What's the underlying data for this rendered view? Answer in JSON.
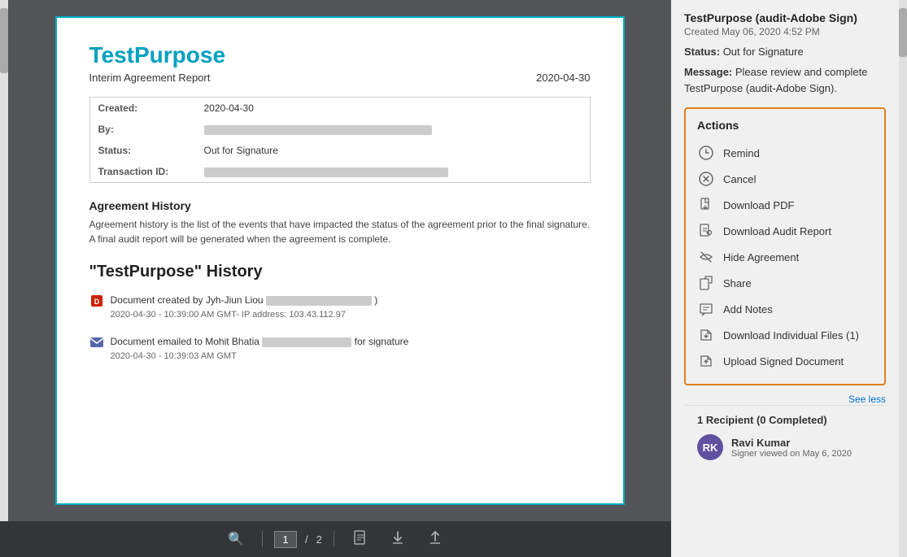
{
  "document": {
    "title": "TestPurpose",
    "subtitle": "Interim Agreement Report",
    "date": "2020-04-30",
    "info": {
      "created_label": "Created:",
      "created_value": "2020-04-30",
      "by_label": "By:",
      "status_label": "Status:",
      "status_value": "Out for Signature",
      "transaction_label": "Transaction ID:"
    },
    "agreement_history_title": "Agreement History",
    "agreement_history_text": "Agreement history is the list of the events that have impacted the status of the agreement prior to the final signature. A final audit report will be generated when the agreement is complete.",
    "history_heading": "\"TestPurpose\" History",
    "history_items": [
      {
        "text": "Document created by Jyh-Jiun Liou",
        "timestamp": "2020-04-30 - 10:39:00 AM GMT- IP address: 103.43.112.97",
        "type": "created"
      },
      {
        "text": "Document emailed to Mohit Bhatia                               for signature",
        "timestamp": "2020-04-30 - 10:39:03 AM GMT",
        "type": "emailed"
      }
    ]
  },
  "toolbar": {
    "search_icon": "🔍",
    "page_current": "1",
    "page_separator": "/",
    "page_total": "2",
    "download_icon": "⬇",
    "upload_icon": "⬆"
  },
  "right_panel": {
    "agreement_title": "TestPurpose (audit-Adobe Sign)",
    "created": "Created May 06, 2020 4:52 PM",
    "status_label": "Status:",
    "status_value": "Out for Signature",
    "message_label": "Message:",
    "message_value": "Please review and complete TestPurpose (audit-Adobe Sign).",
    "actions_title": "Actions",
    "actions": [
      {
        "id": "remind",
        "label": "Remind",
        "icon": "⏰"
      },
      {
        "id": "cancel",
        "label": "Cancel",
        "icon": "✖"
      },
      {
        "id": "download-pdf",
        "label": "Download PDF",
        "icon": "📄"
      },
      {
        "id": "download-audit",
        "label": "Download Audit Report",
        "icon": "📋"
      },
      {
        "id": "hide-agreement",
        "label": "Hide Agreement",
        "icon": "🔒"
      },
      {
        "id": "share",
        "label": "Share",
        "icon": "📤"
      },
      {
        "id": "add-notes",
        "label": "Add Notes",
        "icon": "💬"
      },
      {
        "id": "download-individual",
        "label": "Download Individual Files (1)",
        "icon": "📁"
      },
      {
        "id": "upload-signed",
        "label": "Upload Signed Document",
        "icon": "📝"
      }
    ],
    "see_less": "See less",
    "recipient_count": "1 Recipient (0 Completed)",
    "recipient": {
      "name": "Ravi Kumar",
      "initials": "RK",
      "viewed": "Signer viewed on May 6, 2020"
    }
  }
}
